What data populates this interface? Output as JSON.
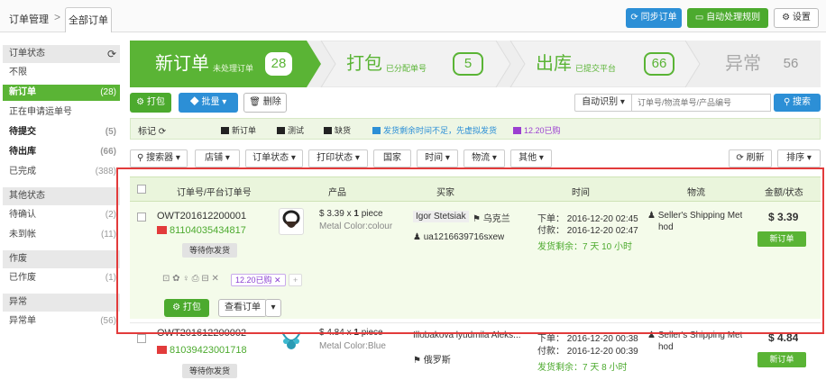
{
  "topbar": {
    "breadcrumb": "订单管理",
    "breadcrumb_sep": ">",
    "tab_all": "全部订单",
    "sync_label": "同步订单",
    "auto_rules_label": "自动处理规则",
    "settings_label": "设置"
  },
  "sidebar": {
    "order_status_header": "订单状态",
    "items": [
      {
        "label": "不限",
        "count": ""
      },
      {
        "label": "新订单",
        "count": "(28)"
      },
      {
        "label": "正在申请运单号",
        "count": ""
      },
      {
        "label": "待提交",
        "count": "(5)"
      },
      {
        "label": "待出库",
        "count": "(66)"
      },
      {
        "label": "已完成",
        "count": "(388)"
      }
    ],
    "other_header": "其他状态",
    "other_items": [
      {
        "label": "待确认",
        "count": "(2)"
      },
      {
        "label": "未到帐",
        "count": "(11)"
      }
    ],
    "void_header": "作废",
    "void_items": [
      {
        "label": "已作废",
        "count": "(1)"
      }
    ],
    "exception_header": "异常",
    "exception_items": [
      {
        "label": "异常单",
        "count": "(56)"
      }
    ]
  },
  "steps": [
    {
      "title": "新订单",
      "sub": "未处理订单",
      "count": "28"
    },
    {
      "title": "打包",
      "sub": "已分配单号",
      "count": "5"
    },
    {
      "title": "出库",
      "sub": "已提交平台",
      "count": "66"
    },
    {
      "title": "异常",
      "sub": "",
      "count": "56"
    }
  ],
  "actions": {
    "pack": "打包",
    "batch": "批量",
    "delete": "删除",
    "auto_detect": "自动识别",
    "search_placeholder": "订单号/物流单号/产品编号",
    "search": "搜索"
  },
  "tags": {
    "label": "标记",
    "items": [
      {
        "text": "新订单",
        "color": "#222222"
      },
      {
        "text": "测试",
        "color": "#222222"
      },
      {
        "text": "缺货",
        "color": "#222222"
      },
      {
        "text": "发货剩余时间不足，先虚拟发货",
        "color": "#2c8fd6"
      },
      {
        "text": "12.20已购",
        "color": "#9b3fd1"
      }
    ]
  },
  "filters": {
    "searcher": "搜索器",
    "shop": "店铺",
    "order_status": "订单状态",
    "print_status": "打印状态",
    "country": "国家",
    "time": "时间",
    "logistics": "物流",
    "other": "其他",
    "refresh": "刷新",
    "sort": "排序"
  },
  "table": {
    "headers": [
      "订单号/平台订单号",
      "产品",
      "买家",
      "时间",
      "物流",
      "金额/状态"
    ],
    "rows": [
      {
        "order_no": "OWT201612200001",
        "platform_no": "81104035434817",
        "status_btn": "等待你发货",
        "product_price": "$ 3.39 x ",
        "product_qty": "1",
        "product_unit": " piece",
        "product_attr": "Metal Color:colour",
        "buyer": "Igor Stetsiak",
        "country": "乌克兰",
        "buyer_id": "ua1216639716sxew",
        "order_time": "下单： 2016-12-20 02:45",
        "pay_time": "付款： 2016-12-20 02:47",
        "remain": "发货剩余：7 天 10 小时",
        "logistics": "Seller's Shipping Met",
        "logistics2": "hod",
        "amount": "$ 3.39",
        "status": "新订单",
        "tag": "12.20已购",
        "pack": "打包",
        "view": "查看订单"
      },
      {
        "order_no": "OWT201612200002",
        "platform_no": "81039423001718",
        "status_btn": "等待你发货",
        "product_price": "$ 4.84 x ",
        "product_qty": "1",
        "product_unit": " piece",
        "product_attr": "Metal Color:Blue",
        "buyer": "Illobakova lyudmila Aleks...",
        "country": "俄罗斯",
        "order_time": "下单： 2016-12-20 00:38",
        "pay_time": "付款： 2016-12-20 00:39",
        "remain": "发货剩余：7 天 8 小时",
        "logistics": "Seller's Shipping Met",
        "logistics2": "hod",
        "amount": "$ 4.84",
        "status": "新订单"
      }
    ]
  },
  "colors": {
    "accent_green": "#5ab435",
    "accent_blue": "#2c8fd6",
    "highlight_red": "#e23b3b"
  }
}
